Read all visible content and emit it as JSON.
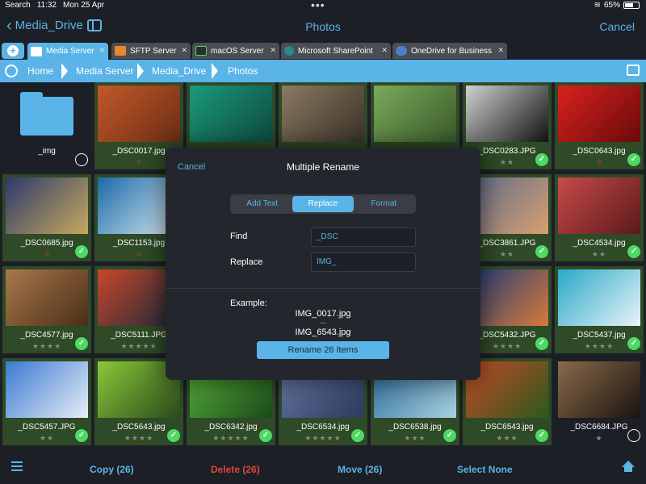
{
  "status": {
    "carrier": "Search",
    "time": "11:32",
    "date": "Mon 25 Apr",
    "battery": "65%",
    "battery_level": 0.65
  },
  "nav": {
    "back_label": "Media_Drive",
    "title": "Photos",
    "cancel_label": "Cancel"
  },
  "tabs": [
    {
      "label": "Media Server",
      "icon": "home-drive-icon",
      "color": "#ffffff"
    },
    {
      "label": "SFTP Server",
      "icon": "sftp-server-icon",
      "color": "#e8872e"
    },
    {
      "label": "macOS Server",
      "icon": "macos-server-icon",
      "color": "#4cd964"
    },
    {
      "label": "Microsoft SharePoint",
      "icon": "sharepoint-icon",
      "color": "#2a8a8a"
    },
    {
      "label": "OneDrive for Business",
      "icon": "onedrive-icon",
      "color": "#4a7fd0"
    }
  ],
  "breadcrumb": [
    "Home",
    "Media Server",
    "Media_Drive",
    "Photos"
  ],
  "grid": [
    {
      "name": "_img",
      "type": "folder",
      "selected": false
    },
    {
      "name": "_DSC0017.jpg",
      "flag": "⦸",
      "stars": "",
      "selected": true,
      "checked": false,
      "c1": "#c4582a",
      "c2": "#6a2e14"
    },
    {
      "name": "",
      "stars": "",
      "selected": true,
      "checked": false,
      "c1": "#1a9a7a",
      "c2": "#0e4a3e"
    },
    {
      "name": "",
      "stars": "",
      "selected": true,
      "checked": false,
      "c1": "#8a7a62",
      "c2": "#3a3228"
    },
    {
      "name": "",
      "stars": "",
      "selected": true,
      "checked": false,
      "c1": "#7aaa5a",
      "c2": "#3a5a2a"
    },
    {
      "name": "_DSC0283.JPG",
      "stars": "★★",
      "selected": true,
      "checked": true,
      "c1": "#d0d0d0",
      "c2": "#111111"
    },
    {
      "name": "_DSC0643.jpg",
      "flag": "⦸",
      "stars": "",
      "selected": true,
      "checked": true,
      "c1": "#d8221e",
      "c2": "#6a0a0a"
    },
    {
      "name": "_DSC0685.jpg",
      "flag": "⦸",
      "stars": "",
      "selected": true,
      "checked": true,
      "c1": "#2a3a6a",
      "c2": "#c8a860"
    },
    {
      "name": "_DSC1153.jpg",
      "flag": "⦸",
      "stars": "",
      "selected": true,
      "checked": false,
      "c1": "#1a6aa8",
      "c2": "#d8e8f0"
    },
    {
      "name": "",
      "stars": "",
      "selected": true,
      "checked": false,
      "c1": "#333",
      "c2": "#222"
    },
    {
      "name": "",
      "stars": "",
      "selected": true,
      "checked": false,
      "c1": "#333",
      "c2": "#222"
    },
    {
      "name": "",
      "stars": "",
      "selected": true,
      "checked": false,
      "c1": "#333",
      "c2": "#222"
    },
    {
      "name": "_DSC3861.JPG",
      "stars": "★★",
      "selected": true,
      "checked": true,
      "c1": "#5a6a8a",
      "c2": "#d8a070"
    },
    {
      "name": "_DSC4534.jpg",
      "stars": "★★",
      "selected": true,
      "checked": true,
      "c1": "#c84a4a",
      "c2": "#5a1a1a"
    },
    {
      "name": "_DSC4577.jpg",
      "stars": "★★★★",
      "selected": true,
      "checked": true,
      "c1": "#a8784a",
      "c2": "#4a2e18"
    },
    {
      "name": "_DSC5111.JPG",
      "stars": "★★★★★",
      "selected": true,
      "checked": false,
      "c1": "#c8462a",
      "c2": "#1a2a3a"
    },
    {
      "name": "",
      "stars": "",
      "selected": true,
      "checked": false,
      "c1": "#333",
      "c2": "#222"
    },
    {
      "name": "",
      "stars": "",
      "selected": true,
      "checked": false,
      "c1": "#333",
      "c2": "#222"
    },
    {
      "name": "",
      "stars": "",
      "selected": true,
      "checked": false,
      "c1": "#333",
      "c2": "#222"
    },
    {
      "name": "_DSC5432.JPG",
      "stars": "★★★★",
      "selected": true,
      "checked": true,
      "c1": "#1a3a7a",
      "c2": "#d87a3a"
    },
    {
      "name": "_DSC5437.jpg",
      "stars": "★★★★",
      "selected": true,
      "checked": true,
      "c1": "#2aa8c8",
      "c2": "#e8f4f8"
    },
    {
      "name": "_DSC5457.JPG",
      "stars": "★★",
      "selected": true,
      "checked": true,
      "c1": "#3a7ad0",
      "c2": "#e8eef8"
    },
    {
      "name": "_DSC5643.jpg",
      "stars": "★★★★",
      "selected": true,
      "checked": true,
      "c1": "#8ac83a",
      "c2": "#2a4a1a"
    },
    {
      "name": "_DSC6342.jpg",
      "stars": "★★★★★",
      "selected": true,
      "checked": true,
      "c1": "#5ab43a",
      "c2": "#1a4a1a"
    },
    {
      "name": "_DSC6534.jpg",
      "stars": "★★★★★",
      "selected": true,
      "checked": true,
      "c1": "#6a7aa8",
      "c2": "#2a3a5a"
    },
    {
      "name": "_DSC6538.jpg",
      "stars": "★★★",
      "selected": true,
      "checked": true,
      "c1": "#2a6a9a",
      "c2": "#a8d0e0"
    },
    {
      "name": "_DSC6543.jpg",
      "stars": "★★★",
      "selected": true,
      "checked": true,
      "c1": "#c84a2a",
      "c2": "#2a5a1a"
    },
    {
      "name": "_DSC6684.JPG",
      "stars": "★",
      "selected": false,
      "checked": false,
      "c1": "#8a6a4a",
      "c2": "#1a1410"
    }
  ],
  "modal": {
    "cancel_label": "Cancel",
    "title": "Multiple Rename",
    "segments": [
      "Add Text",
      "Replace",
      "Format"
    ],
    "active_segment": 1,
    "find_label": "Find",
    "find_value": "_DSC",
    "replace_label": "Replace",
    "replace_value": "IMG_",
    "example_label": "Example:",
    "example_first": "IMG_0017.jpg",
    "example_ellipsis": "...",
    "example_last": "IMG_6543.jpg",
    "rename_label": "Rename 26 Items"
  },
  "toolbar": {
    "copy_label": "Copy (26)",
    "delete_label": "Delete (26)",
    "move_label": "Move (26)",
    "select_none_label": "Select None"
  },
  "colors": {
    "accent": "#5ab4e8",
    "danger": "#e0463a",
    "check": "#4cd964",
    "selected_bg": "#2e4a26"
  }
}
